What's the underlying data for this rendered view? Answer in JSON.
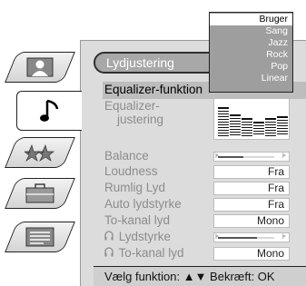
{
  "tabs": [
    {
      "icon": "person-icon",
      "active": false
    },
    {
      "icon": "music-note-icon",
      "active": true
    },
    {
      "icon": "stars-icon",
      "active": false
    },
    {
      "icon": "briefcase-icon",
      "active": false
    },
    {
      "icon": "document-icon",
      "active": false
    }
  ],
  "panel": {
    "title": "Lydjustering",
    "rows": [
      {
        "label": "Equalizer-funktion",
        "selected": true
      },
      {
        "label": "Equalizer-",
        "label2": "justering"
      },
      {
        "label": "Balance",
        "control": "slider"
      },
      {
        "label": "Loudness",
        "value": "Fra"
      },
      {
        "label": "Rumlig Lyd",
        "value": "Fra"
      },
      {
        "label": "Auto lydstyrke",
        "value": "Fra"
      },
      {
        "label": "To-kanal lyd",
        "value": "Mono"
      },
      {
        "label": "Lydstyrke",
        "icon": "headphones-icon",
        "control": "slider"
      },
      {
        "label": "To-kanal lyd",
        "icon": "headphones-icon",
        "value": "Mono"
      }
    ],
    "slider_marks": {
      "low": "⊧",
      "high": "⊧"
    },
    "balance_level": 0.45,
    "headphone_volume_level": 0.7,
    "equalizer_levels": [
      0.8,
      0.6,
      0.5,
      0.4,
      0.5,
      0.55
    ]
  },
  "hint": "Vælg funktion: ▲▼ Bekræft: OK",
  "dropdown": {
    "items": [
      "Bruger",
      "Sang",
      "Jazz",
      "Rock",
      "Pop",
      "Linear"
    ],
    "selected": "Bruger"
  },
  "colors": {
    "panel_bg": "#dcdcdc",
    "dropdown_bg": "#9e9e9e",
    "highlight": "#bdbdbd",
    "title_bg": "#a8a8a8"
  }
}
